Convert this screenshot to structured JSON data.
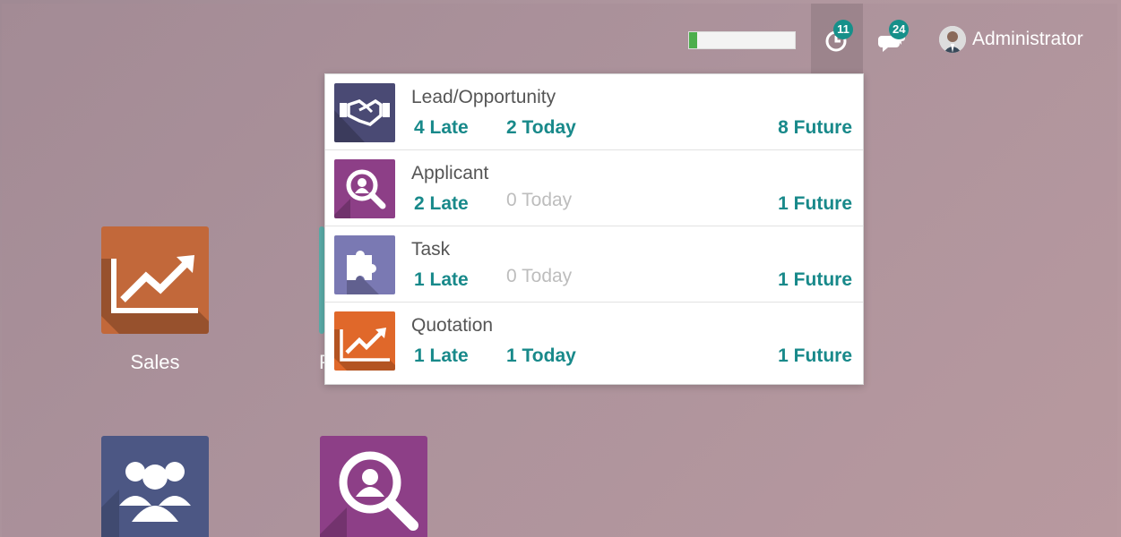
{
  "topbar": {
    "progress_fraction": 0.08,
    "activity_badge": "11",
    "messages_badge": "24",
    "user_name": "Administrator"
  },
  "apps": [
    {
      "label": "Sales"
    },
    {
      "label": "P"
    },
    {
      "label": ""
    },
    {
      "label": ""
    }
  ],
  "activities": [
    {
      "name": "Lead/Opportunity",
      "late": "4 Late",
      "today": "2 Today",
      "future": "8 Future",
      "icon": "handshake-icon"
    },
    {
      "name": "Applicant",
      "late": "2 Late",
      "today": "0 Today",
      "future": "1 Future",
      "icon": "search-person-icon"
    },
    {
      "name": "Task",
      "late": "1 Late",
      "today": "0 Today",
      "future": "1 Future",
      "icon": "puzzle-icon"
    },
    {
      "name": "Quotation",
      "late": "1 Late",
      "today": "1 Today",
      "future": "1 Future",
      "icon": "trend-chart-icon"
    }
  ],
  "colors": {
    "accent": "#18898a",
    "badge": "#16908a",
    "muted": "#bdbdbd"
  }
}
